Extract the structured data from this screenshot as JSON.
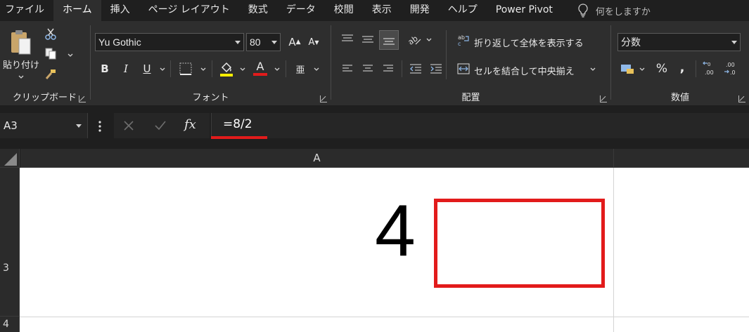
{
  "tabs": [
    "ファイル",
    "ホーム",
    "挿入",
    "ページ レイアウト",
    "数式",
    "データ",
    "校閲",
    "表示",
    "開発",
    "ヘルプ",
    "Power Pivot"
  ],
  "active_tab": "ホーム",
  "tell_me": "何をしますか",
  "ribbon": {
    "clipboard": {
      "label": "クリップボード",
      "paste": "貼り付け"
    },
    "font": {
      "label": "フォント",
      "name": "Yu Gothic",
      "size": "80",
      "bold": "B",
      "italic": "I",
      "underline": "U",
      "grow": "A",
      "shrink": "A",
      "font_color_glyph": "A",
      "phonetic_glyph": "亜"
    },
    "alignment": {
      "label": "配置",
      "wrap": "折り返して全体を表示する",
      "merge": "セルを結合して中央揃え"
    },
    "number": {
      "label": "数値",
      "format": "分数",
      "percent": "%",
      "comma": ","
    }
  },
  "formula_bar": {
    "name_box": "A3",
    "formula": "=8/2",
    "fx": "fx"
  },
  "grid": {
    "columns": [
      "A"
    ],
    "rows": [
      "3",
      "4"
    ],
    "cell_a3_value": "4"
  },
  "colors": {
    "highlight": "#e21b1b",
    "fill_yellow": "#ffee00",
    "font_red": "#e21b1b"
  }
}
